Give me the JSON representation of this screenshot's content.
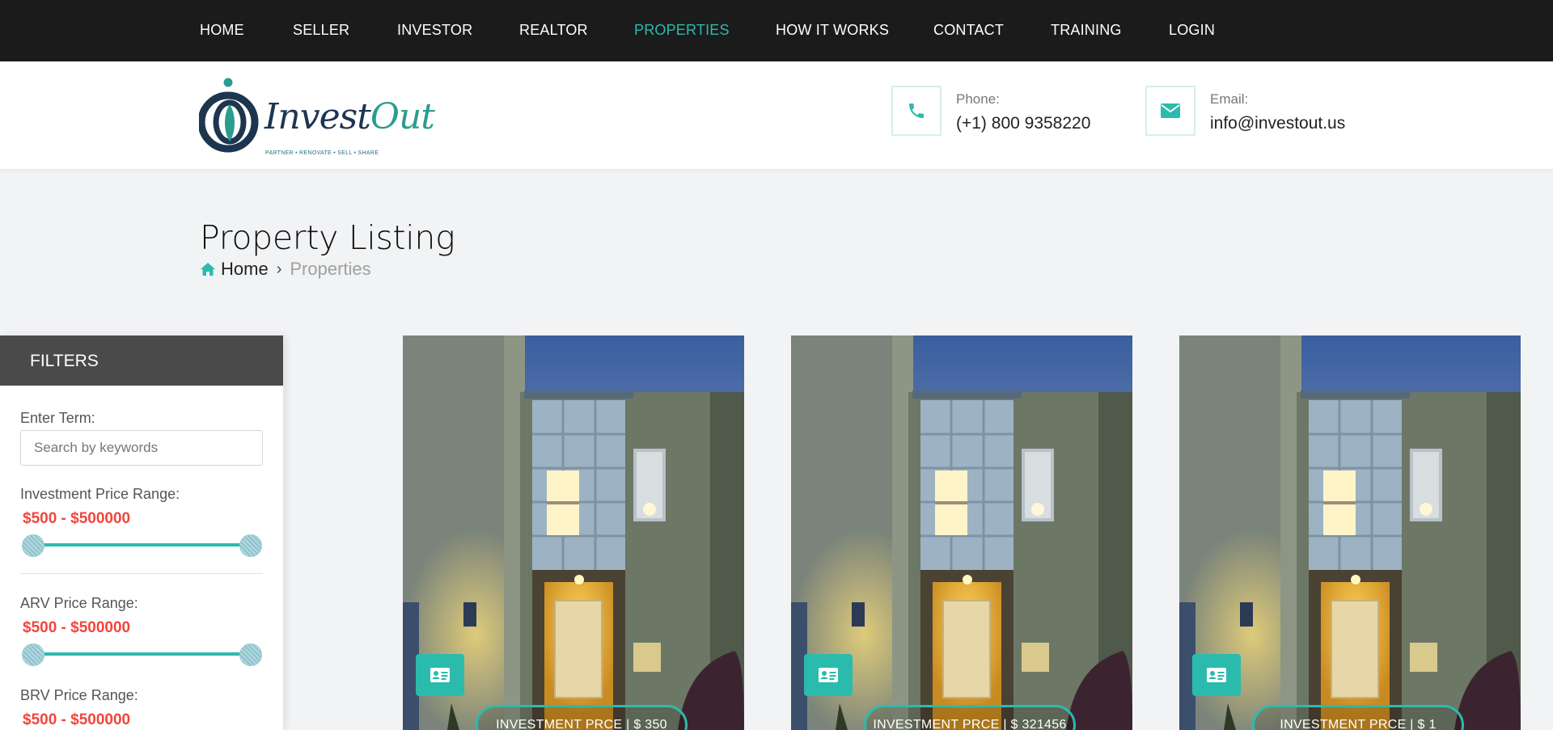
{
  "nav": {
    "items": [
      {
        "label": "HOME"
      },
      {
        "label": "SELLER"
      },
      {
        "label": "INVESTOR"
      },
      {
        "label": "REALTOR"
      },
      {
        "label": "PROPERTIES",
        "active": true
      },
      {
        "label": "HOW IT WORKS"
      },
      {
        "label": "CONTACT"
      },
      {
        "label": "TRAINING"
      },
      {
        "label": "LOGIN"
      }
    ]
  },
  "header": {
    "logo": {
      "text_main": "Invest",
      "text_accent": "Out",
      "tagline": "PARTNER • RENOVATE • SELL • SHARE"
    },
    "phone": {
      "label": "Phone:",
      "value": "(+1) 800 9358220",
      "icon": "phone-icon"
    },
    "email": {
      "label": "Email:",
      "value": "info@investout.us",
      "icon": "envelope-icon"
    }
  },
  "page": {
    "title": "Property Listing",
    "breadcrumb": {
      "home": "Home",
      "current": "Properties"
    }
  },
  "filters": {
    "heading": "FILTERS",
    "term_label": "Enter Term:",
    "term_placeholder": "Search by keywords",
    "investment": {
      "label": "Investment Price Range:",
      "range": "$500 - $500000",
      "min": 500,
      "max": 500000
    },
    "arv": {
      "label": "ARV Price Range:",
      "range": "$500 - $500000",
      "min": 500,
      "max": 500000
    },
    "brv": {
      "label": "BRV Price Range:",
      "range": "$500 - $500000"
    }
  },
  "properties": [
    {
      "price_label": "INVESTMENT PRCE | $ 350"
    },
    {
      "price_label": "INVESTMENT PRCE | $ 321456"
    },
    {
      "price_label": "INVESTMENT PRCE | $ 1"
    }
  ],
  "colors": {
    "accent": "#2bbbad",
    "nav_bg": "#1b1b1b",
    "price_red": "#f0463c",
    "filter_head": "#4a4a4a"
  }
}
